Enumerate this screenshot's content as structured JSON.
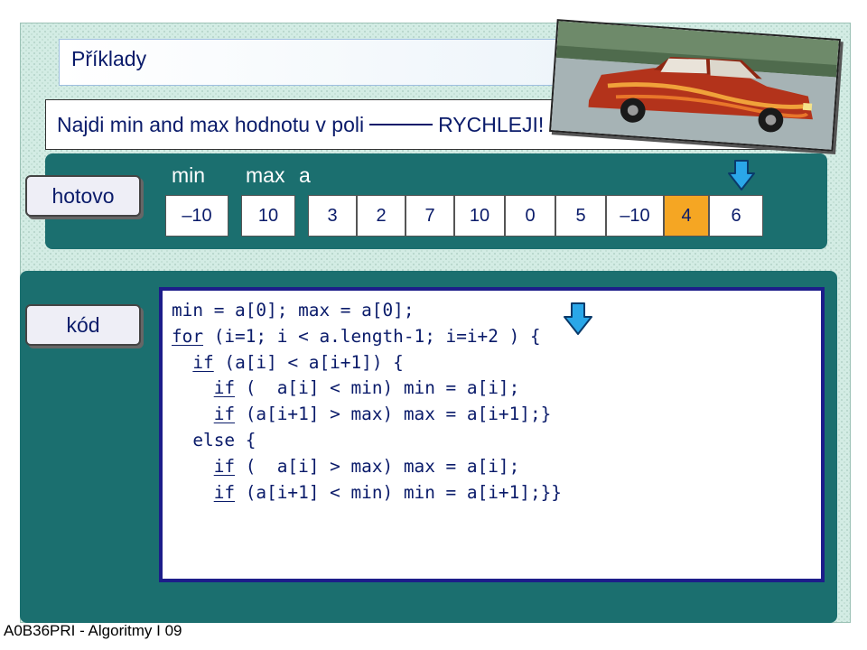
{
  "slide": {
    "title": "Příklady",
    "task": {
      "before": "Najdi min and max hodnotu v poli",
      "after": "RYCHLEJI!"
    },
    "footer": "A0B36PRI - Algoritmy I 09"
  },
  "array_section": {
    "button_label": "hotovo",
    "headers": {
      "min": "min",
      "max": "max",
      "a": "a"
    },
    "min_value": "–10",
    "max_value": "10",
    "values": [
      "3",
      "2",
      "7",
      "10",
      "0",
      "5",
      "–10",
      "4",
      "6"
    ],
    "highlighted_index": 7,
    "highlight_color": "#f5a623"
  },
  "code_section": {
    "label": "kód",
    "lines": [
      {
        "kw": "",
        "indent": "",
        "rest": "min = a[0]; max = a[0];"
      },
      {
        "kw": "for",
        "indent": "",
        "rest": " (i=1; i < a.length-1; i=i+2 ) {"
      },
      {
        "kw": "if",
        "indent": "  ",
        "rest": " (a[i] < a[i+1]) {"
      },
      {
        "kw": "if",
        "indent": "    ",
        "rest": " (  a[i] < min) min = a[i];"
      },
      {
        "kw": "if",
        "indent": "    ",
        "rest": " (a[i+1] > max) max = a[i+1];}"
      },
      {
        "kw": "",
        "indent": "  ",
        "rest": "else {"
      },
      {
        "kw": "if",
        "indent": "    ",
        "rest": " (  a[i] > max) max = a[i];"
      },
      {
        "kw": "if",
        "indent": "    ",
        "rest": " (a[i+1] < min) min = a[i+1];}}"
      }
    ]
  },
  "colors": {
    "panel": "#1b6f6f",
    "text": "#0a1b6a",
    "arrow": "#2aa7e8"
  },
  "icons": [
    "down-arrow-icon",
    "car-photo"
  ]
}
